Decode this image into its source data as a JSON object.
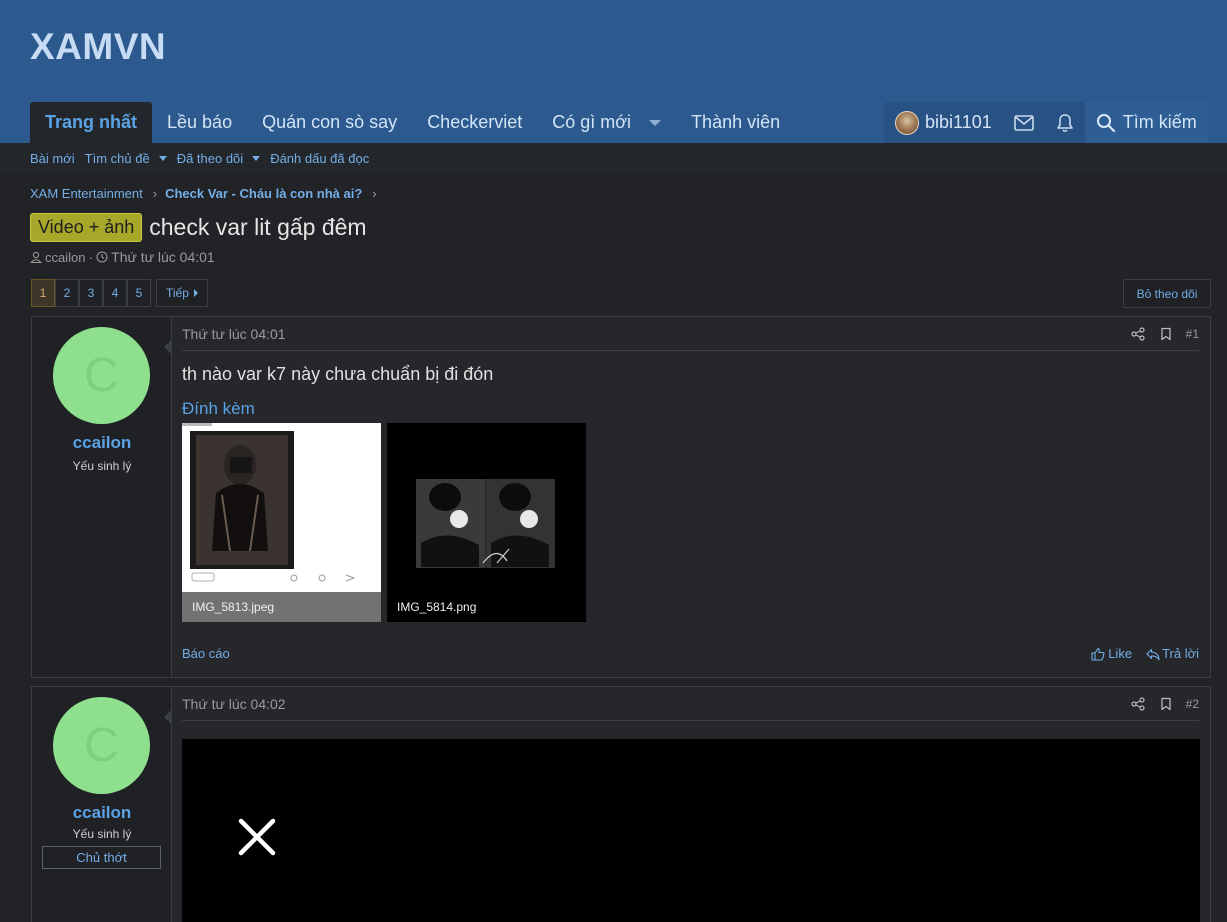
{
  "site": {
    "logo": "XAMVN"
  },
  "nav": {
    "tabs": [
      {
        "label": "Trang nhất"
      },
      {
        "label": "Lều báo"
      },
      {
        "label": "Quán con sò say"
      },
      {
        "label": "Checkerviet"
      },
      {
        "label": "Có gì mới"
      },
      {
        "label": "Thành viên"
      }
    ],
    "user": {
      "name": "bibi1101"
    },
    "search_label": "Tìm kiếm"
  },
  "subnav": {
    "items": [
      {
        "label": "Bài mới"
      },
      {
        "label": "Tìm chủ đề"
      },
      {
        "label": "Đã theo dõi"
      },
      {
        "label": "Đánh dấu đã đọc"
      }
    ]
  },
  "breadcrumb": [
    {
      "label": "XAM Entertainment"
    },
    {
      "label": "Check Var - Cháu là con nhà ai?"
    }
  ],
  "thread": {
    "prefix": "Video + ảnh",
    "title": "check var lit gấp đêm",
    "author": "ccailon",
    "date": "Thứ tư lúc 04:01"
  },
  "pagination": {
    "pages": [
      "1",
      "2",
      "3",
      "4",
      "5"
    ],
    "current": "1",
    "next_label": "Tiếp"
  },
  "follow_label": "Bỏ theo dõi",
  "posts": [
    {
      "author": "ccailon",
      "avatar_letter": "C",
      "user_title": "Yếu sinh lý",
      "date": "Thứ tư lúc 04:01",
      "number": "#1",
      "body": "th nào var k7 này chưa chuẩn bị đi đón",
      "attachments_label": "Đính kèm",
      "attachments": [
        {
          "name": "IMG_5813.jpeg"
        },
        {
          "name": "IMG_5814.png"
        }
      ],
      "report_label": "Báo cáo",
      "like_label": "Like",
      "reply_label": "Trả lời"
    },
    {
      "author": "ccailon",
      "avatar_letter": "C",
      "user_title": "Yếu sinh lý",
      "user_banner": "Chủ thớt",
      "date": "Thứ tư lúc 04:02",
      "number": "#2"
    }
  ],
  "colors": {
    "header_bg": "#2c5a8e",
    "link": "#74aee6",
    "prefix_bg": "#a7a82a",
    "avatar_bg": "#8fe08e",
    "page_bg": "#222326"
  }
}
